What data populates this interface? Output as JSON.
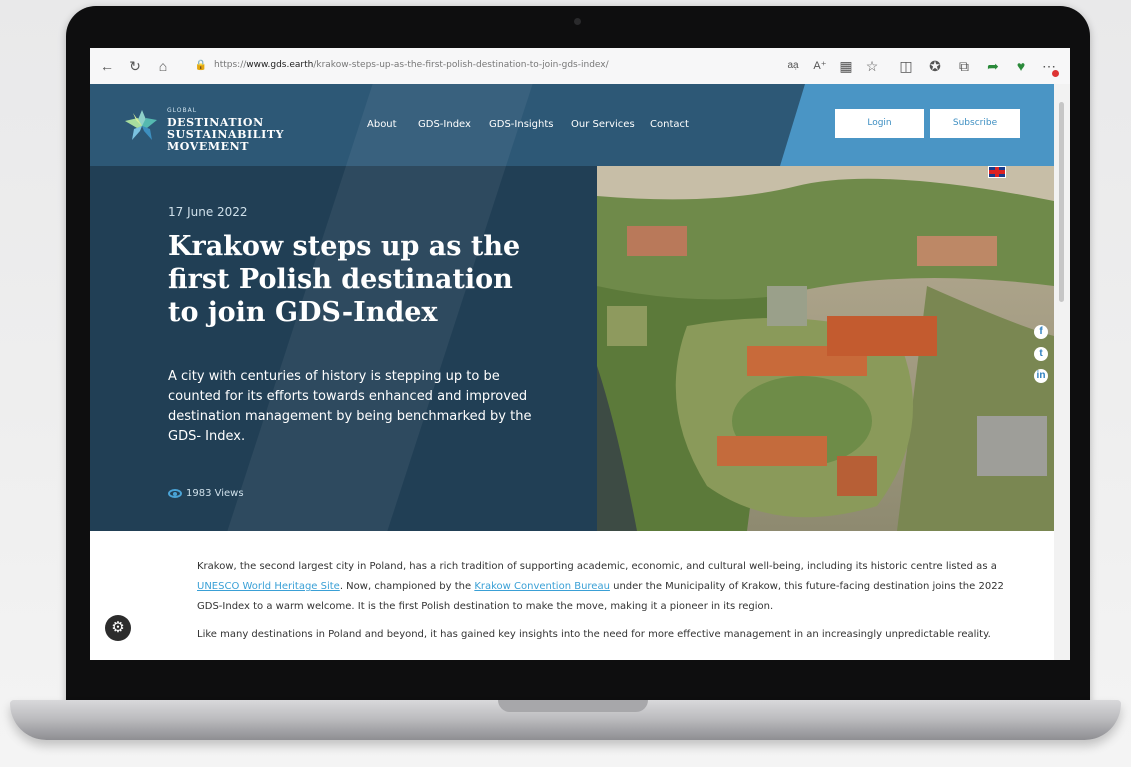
{
  "browser": {
    "url_prefix": "https://",
    "url_domain": "www.gds.earth",
    "url_path": "/krakow-steps-up-as-the-first-polish-destination-to-join-gds-index/",
    "icons": [
      "back-icon",
      "refresh-icon",
      "home-icon",
      "lock-icon",
      "read-aloud-icon",
      "text-size-icon",
      "reader-icon",
      "favorite-icon",
      "split-screen-icon",
      "favorites-icon",
      "collections-icon",
      "extension-icon",
      "performance-icon",
      "menu-icon"
    ]
  },
  "site": {
    "logo": {
      "small": "GLOBAL",
      "line1": "DESTINATION",
      "line2": "SUSTAINABILITY",
      "line3": "MOVEMENT"
    },
    "nav": [
      "About",
      "GDS-Index",
      "GDS-Insights",
      "Our Services",
      "Contact"
    ],
    "login_label": "Login",
    "subscribe_label": "Subscribe"
  },
  "article": {
    "date": "17 June 2022",
    "title": "Krakow steps up as the first Polish destination to join GDS-Index",
    "lede": "A city with centuries of history is stepping up to be counted for its efforts towards enhanced and improved destination management by being benchmarked by the GDS- Index.",
    "views": "1983 Views",
    "p1_a": "Krakow, the second largest city in Poland, has a rich tradition of supporting academic, economic, and cultural well-being, including its historic centre listed as a ",
    "p1_link1": "UNESCO World Heritage Site",
    "p1_b": ". Now, championed by the ",
    "p1_link2": "Krakow Convention Bureau",
    "p1_c": " under the Municipality of Krakow, this future-facing destination joins the 2022 GDS-Index to a warm welcome. It is the first Polish destination to make the move, making it a pioneer in its region.",
    "p2": "Like many destinations in Poland and beyond, it has gained key insights into the need for more effective management in an increasingly unpredictable reality."
  },
  "colors": {
    "accent": "#4a95c5",
    "hero_dark": "#213f55",
    "link": "#3aa0d6"
  }
}
